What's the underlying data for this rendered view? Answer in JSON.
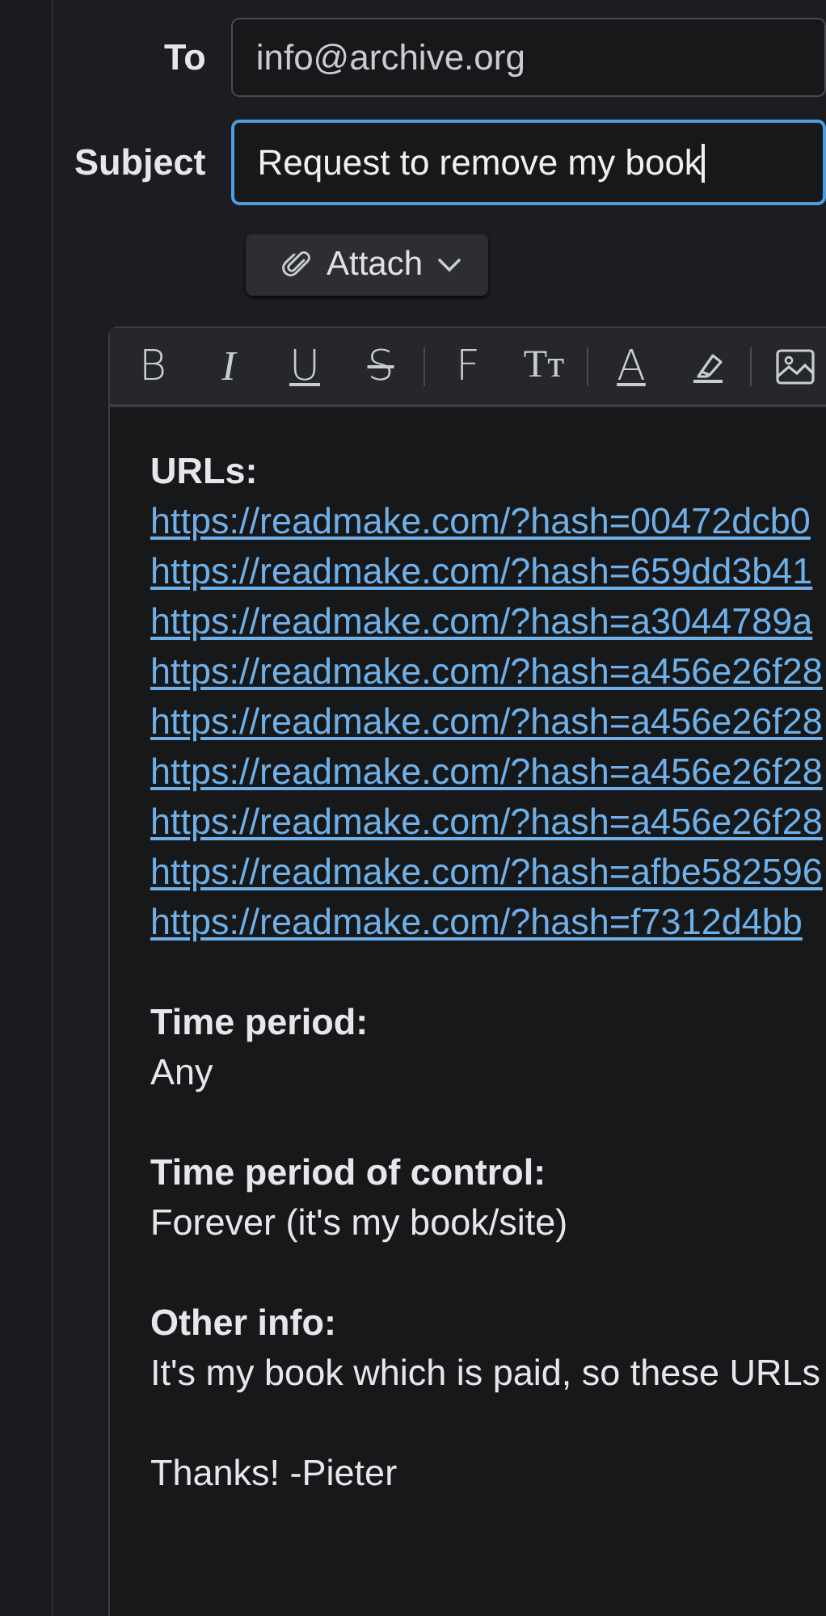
{
  "fields": [
    {
      "label": "To",
      "value": "info@archive.org",
      "focused": false
    },
    {
      "label": "Subject",
      "value": "Request to remove my book",
      "focused": true
    }
  ],
  "attach_button": {
    "label": "Attach"
  },
  "toolbar_groups": [
    [
      {
        "kind": "bold",
        "label": "B"
      },
      {
        "kind": "italic",
        "label": "I"
      },
      {
        "kind": "underline",
        "label": "U"
      },
      {
        "kind": "strike",
        "label": "S"
      }
    ],
    [
      {
        "kind": "plain",
        "label": "F"
      },
      {
        "kind": "size",
        "label": "Tт"
      }
    ],
    [
      {
        "kind": "underline",
        "label": "A"
      },
      {
        "kind": "highlighter"
      }
    ],
    [
      {
        "kind": "image"
      }
    ]
  ],
  "body": [
    {
      "heading": "URLs:",
      "kind": "links",
      "lines": [
        "https://readmake.com/?hash=00472dcb0",
        "https://readmake.com/?hash=659dd3b41",
        "https://readmake.com/?hash=a3044789a",
        "https://readmake.com/?hash=a456e26f28",
        "https://readmake.com/?hash=a456e26f28",
        "https://readmake.com/?hash=a456e26f28",
        "https://readmake.com/?hash=a456e26f28",
        "https://readmake.com/?hash=afbe582596",
        "https://readmake.com/?hash=f7312d4bb"
      ]
    },
    {
      "heading": "Time period:",
      "kind": "text",
      "lines": [
        "Any"
      ]
    },
    {
      "heading": "Time period of control:",
      "kind": "text",
      "lines": [
        "Forever (it's my book/site)"
      ]
    },
    {
      "heading": "Other info:",
      "kind": "text",
      "lines": [
        "It's my book which is paid, so these URLs"
      ]
    },
    {
      "kind": "text",
      "lines": [
        "Thanks! -Pieter"
      ]
    }
  ]
}
